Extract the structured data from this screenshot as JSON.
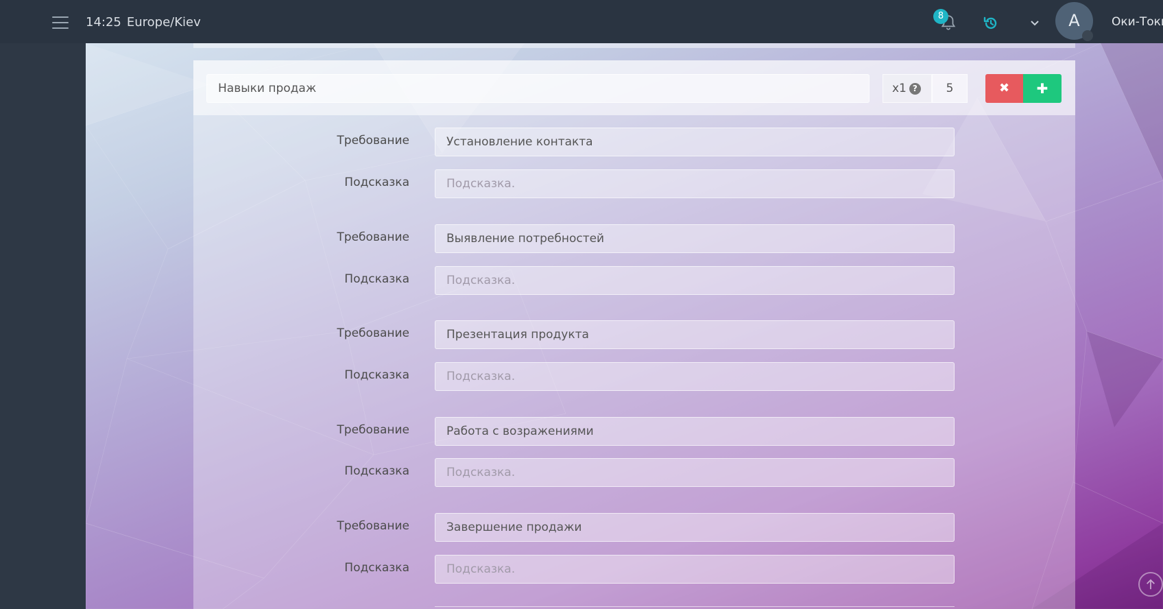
{
  "header": {
    "time": "14:25",
    "timezone": "Europe/Kiev",
    "notifications_count": "8",
    "avatar_letter": "A",
    "username": "Оки-Токи"
  },
  "skill_group": {
    "name_value": "Навыки продаж",
    "multiplier_label": "x1",
    "help_glyph": "?",
    "count_value": "5",
    "delete_glyph": "✖",
    "add_glyph": "✚"
  },
  "labels": {
    "requirement": "Требование",
    "hint": "Подсказка",
    "hint_placeholder": "Подсказка."
  },
  "requirements": [
    {
      "requirement": "Установление контакта",
      "hint": ""
    },
    {
      "requirement": "Выявление потребностей",
      "hint": ""
    },
    {
      "requirement": "Презентация продукта",
      "hint": ""
    },
    {
      "requirement": "Работа с возражениями",
      "hint": ""
    },
    {
      "requirement": "Завершение продажи",
      "hint": ""
    }
  ],
  "colors": {
    "delete_button": "#e75a5e",
    "add_button": "#1ec87e",
    "badge": "#1fb5c6",
    "history_icon": "#1fb5c6"
  }
}
